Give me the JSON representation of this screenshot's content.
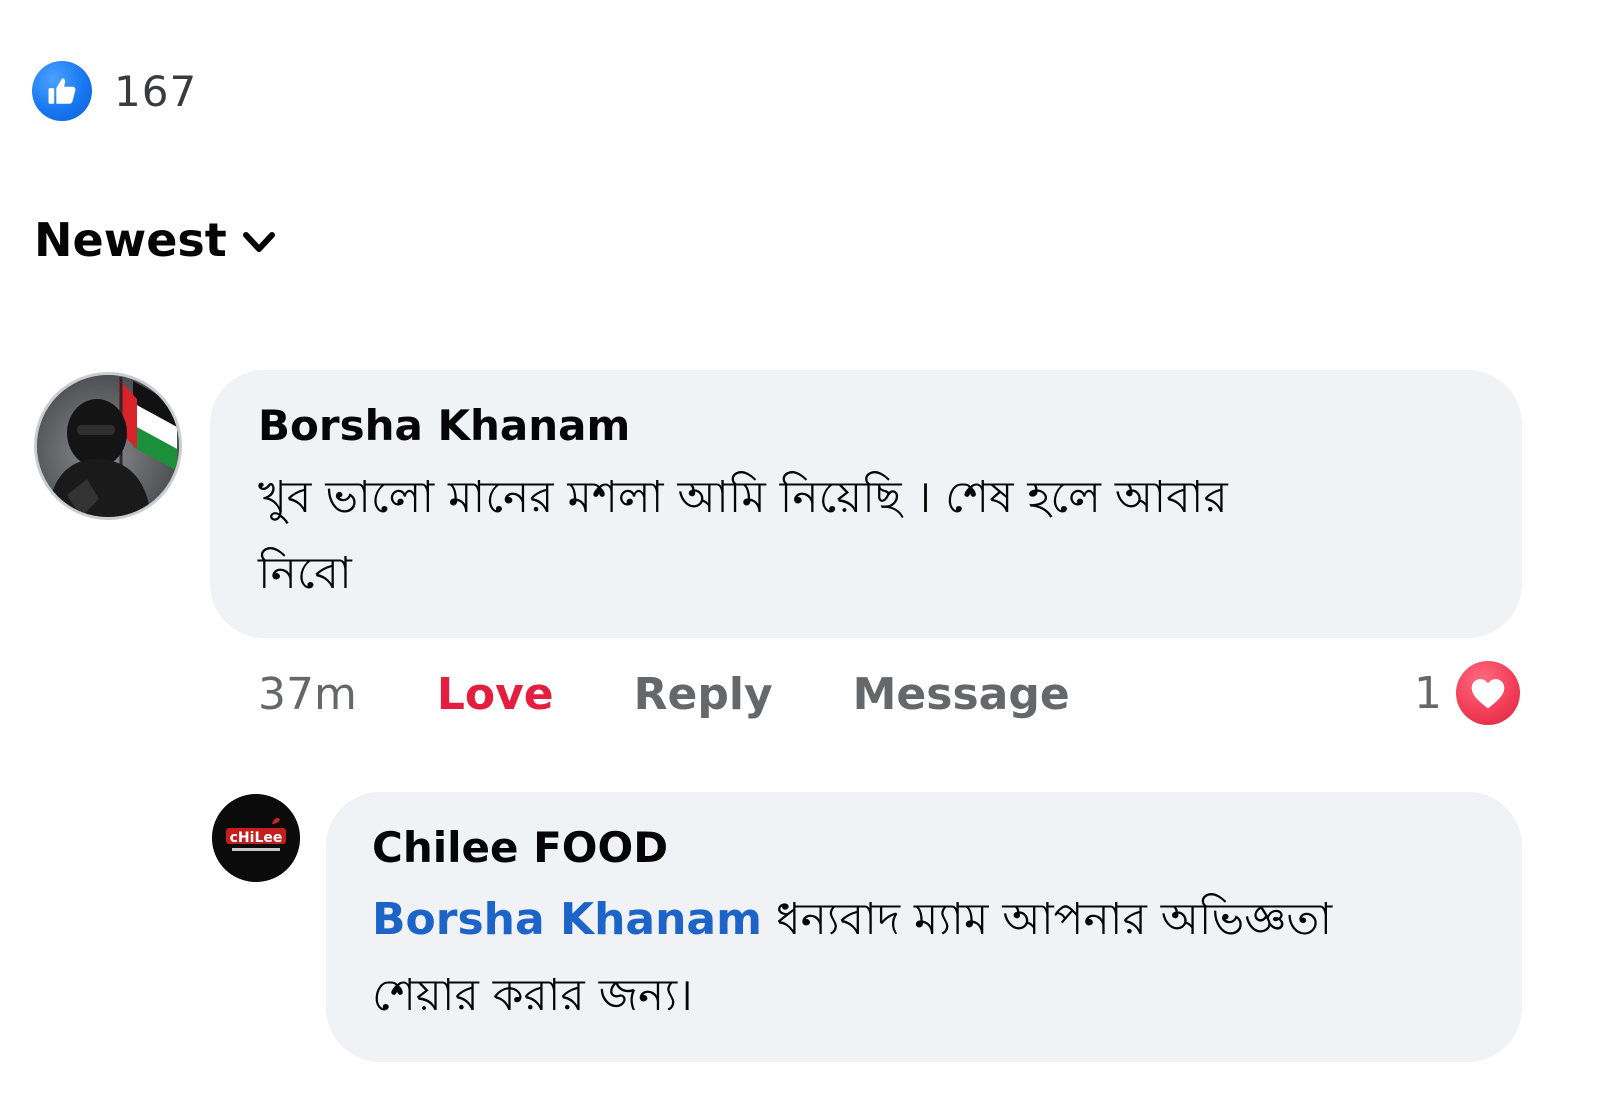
{
  "reactions": {
    "like_count": "167",
    "icon": "like-thumbs-up-icon"
  },
  "sort": {
    "label": "Newest",
    "icon": "chevron-down-icon"
  },
  "comment": {
    "author": "Borsha Khanam",
    "text_line1": "খুব ভালো মানের মশলা আমি নিয়েছি । শেষ হলে আবার",
    "text_line2": "নিবো",
    "timestamp": "37m",
    "love_label": "Love",
    "reply_label": "Reply",
    "message_label": "Message",
    "reaction_count": "1",
    "reaction_icon": "heart-icon",
    "love_color": "#e41e3f"
  },
  "reply": {
    "author": "Chilee FOOD",
    "mention": "Borsha Khanam",
    "text_line1": " ধন্যবাদ ম্যাম আপনার অভিজ্ঞতা",
    "text_line2": "শেয়ার করার জন্য।",
    "avatar_logo_text": "cHiLee",
    "mention_color": "#1d64c9"
  },
  "colors": {
    "bubble_bg": "#f0f2f5",
    "like_blue": "#1877f2",
    "secondary_text": "#65676b"
  }
}
